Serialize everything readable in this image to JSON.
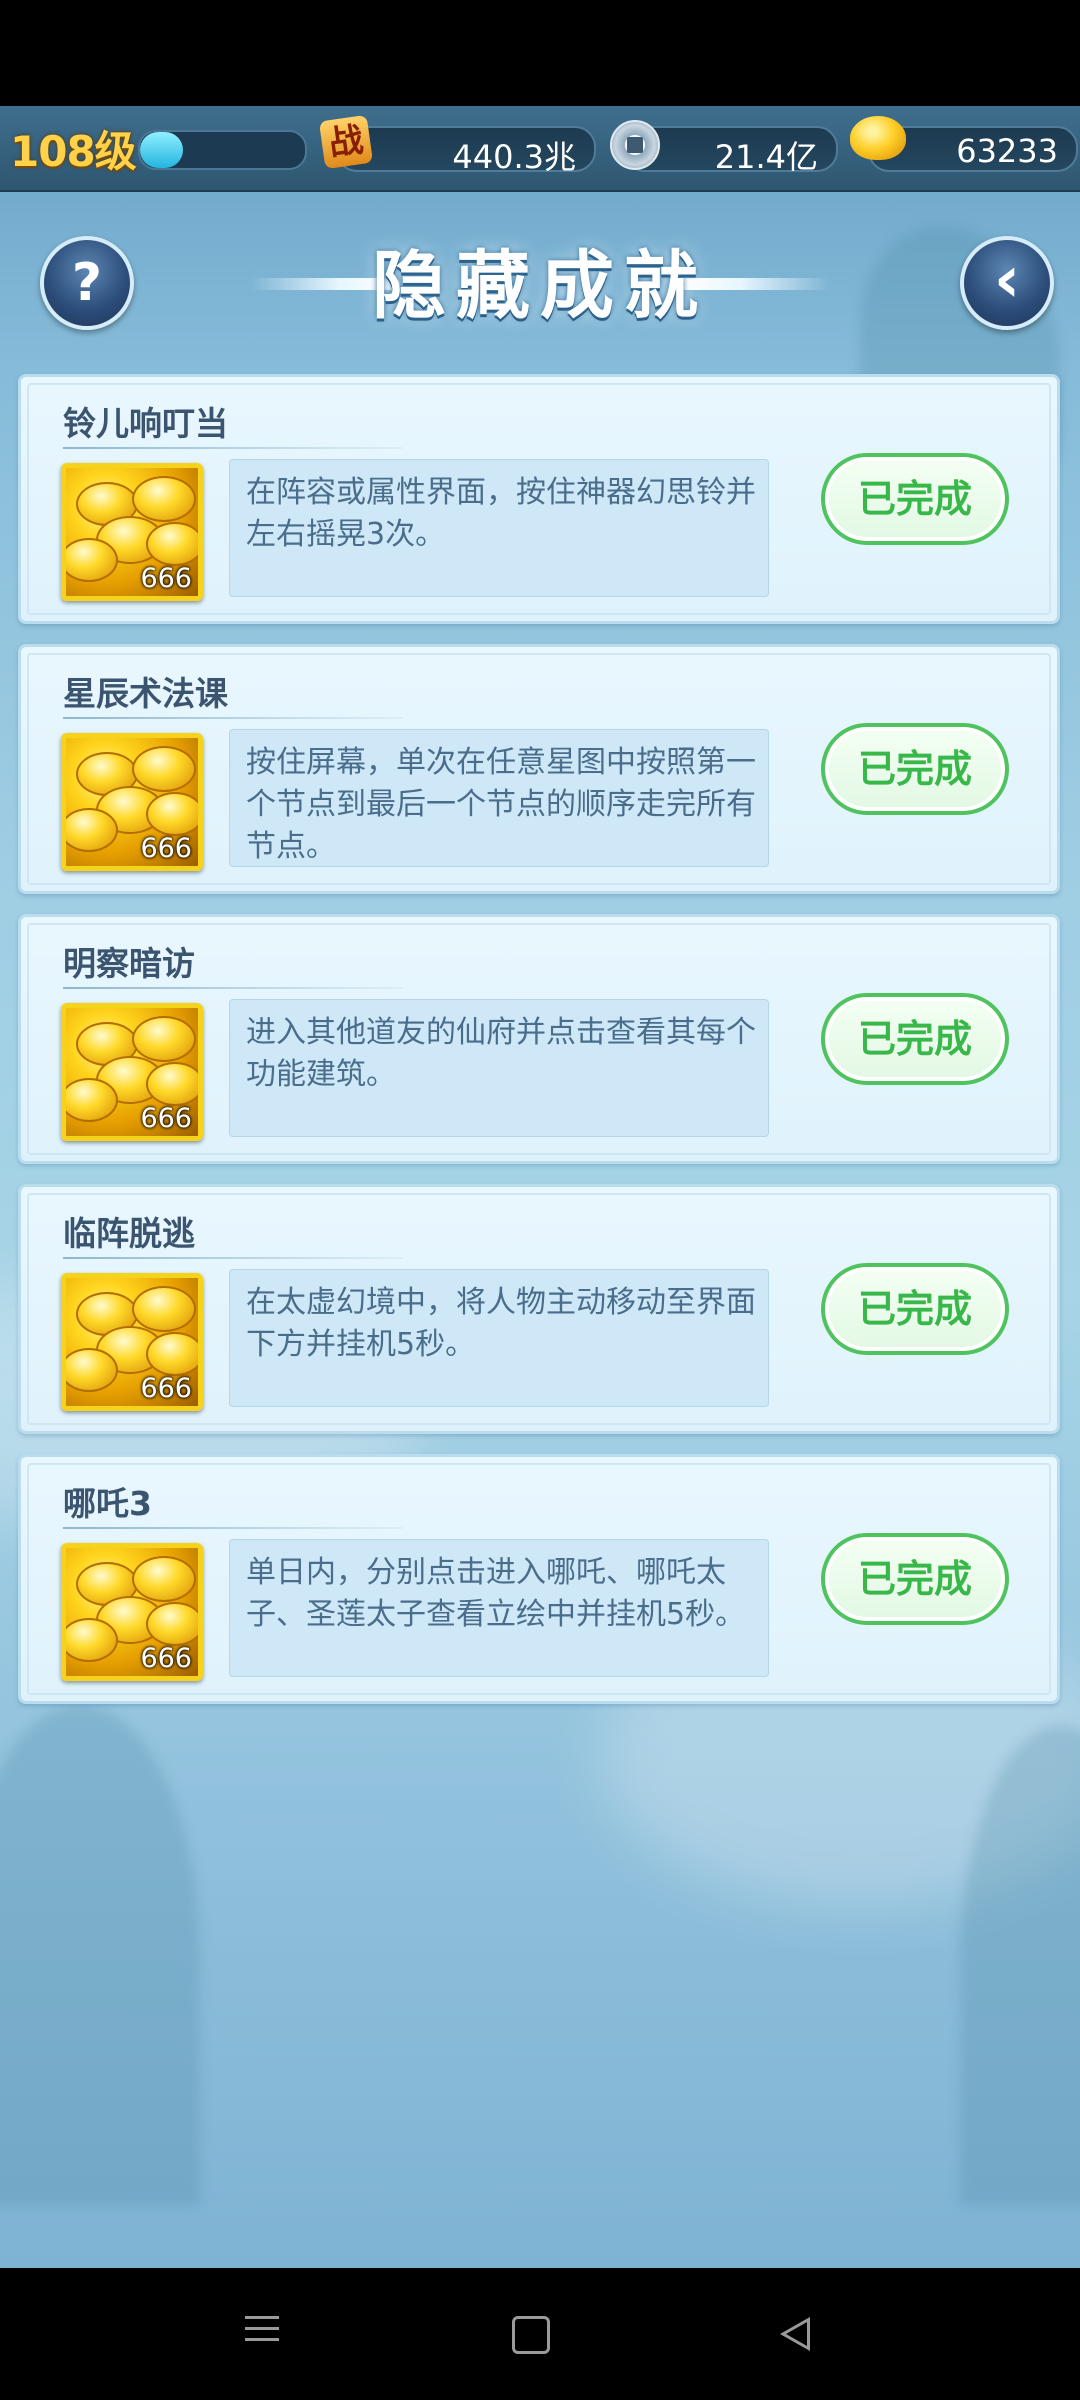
{
  "topbar": {
    "level": "108级",
    "exp_progress_fraction": 0.26,
    "battle_icon_char": "战",
    "battle_power": "440.3兆",
    "coin_amount": "21.4亿",
    "gold_amount": "63233"
  },
  "header": {
    "title": "隐藏成就",
    "help_glyph": "?",
    "back_glyph": "‹"
  },
  "achievements": [
    {
      "name": "铃儿响叮当",
      "description": "在阵容或属性界面，按住神器幻思铃并左右摇晃3次。",
      "reward_count": "666",
      "status": "已完成"
    },
    {
      "name": "星辰术法课",
      "description": "按住屏幕，单次在任意星图中按照第一个节点到最后一个节点的顺序走完所有节点。",
      "reward_count": "666",
      "status": "已完成"
    },
    {
      "name": "明察暗访",
      "description": "进入其他道友的仙府并点击查看其每个功能建筑。",
      "reward_count": "666",
      "status": "已完成"
    },
    {
      "name": "临阵脱逃",
      "description": "在太虚幻境中，将人物主动移动至界面下方并挂机5秒。",
      "reward_count": "666",
      "status": "已完成"
    },
    {
      "name": "哪吒3",
      "description": "单日内，分别点击进入哪吒、哪吒太子、圣莲太子查看立绘中并挂机5秒。",
      "reward_count": "666",
      "status": "已完成"
    }
  ],
  "colors": {
    "done_green": "#39b84a",
    "gold_yellow": "#ffd24a"
  }
}
